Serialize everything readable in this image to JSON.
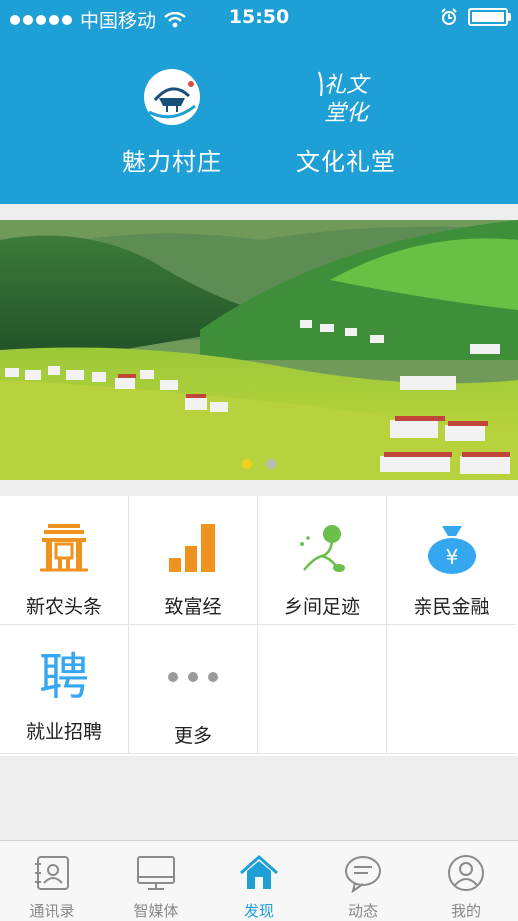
{
  "status_bar": {
    "carrier": "中国移动",
    "time": "15:50"
  },
  "header": {
    "items": [
      {
        "label": "魅力村庄",
        "logo_text": ""
      },
      {
        "label": "文化礼堂",
        "logo_text": "礼文堂化"
      }
    ]
  },
  "banner": {
    "pages": 2,
    "active_page": 1
  },
  "grid": {
    "items": [
      {
        "label": "新农头条",
        "icon": "temple-gate-icon"
      },
      {
        "label": "致富经",
        "icon": "bar-chart-icon"
      },
      {
        "label": "乡间足迹",
        "icon": "sprout-icon"
      },
      {
        "label": "亲民金融",
        "icon": "money-bag-icon"
      },
      {
        "label": "就业招聘",
        "icon": "hire-icon",
        "glyph": "聘"
      },
      {
        "label": "更多",
        "icon": "more-dots-icon"
      }
    ]
  },
  "tabbar": {
    "active": "发现",
    "items": [
      {
        "label": "通讯录",
        "icon": "contacts-icon"
      },
      {
        "label": "智媒体",
        "icon": "monitor-icon"
      },
      {
        "label": "发现",
        "icon": "home-icon"
      },
      {
        "label": "动态",
        "icon": "chat-bubble-icon"
      },
      {
        "label": "我的",
        "icon": "user-icon"
      }
    ]
  },
  "colors": {
    "primary": "#1e9fd6",
    "accent_orange": "#f0921e",
    "accent_green": "#6cbf4a",
    "accent_blue": "#35a6f0"
  }
}
